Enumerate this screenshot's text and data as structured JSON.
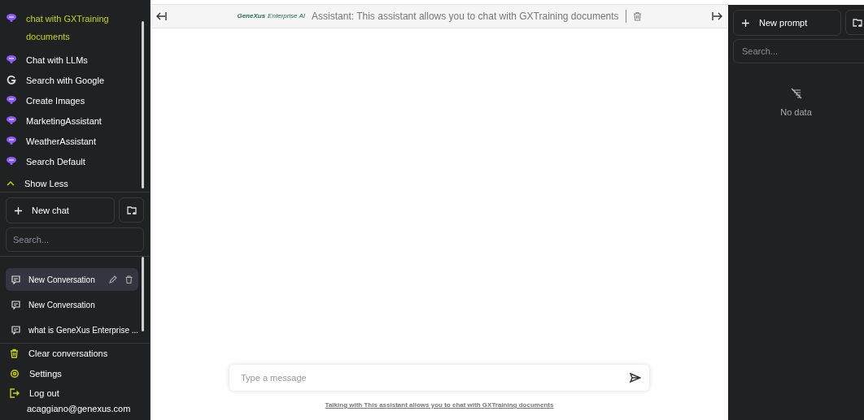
{
  "assistants": [
    {
      "label": "chat with GXTraining documents",
      "kind": "assistant",
      "selected": true
    },
    {
      "label": "Chat with LLMs",
      "kind": "assistant",
      "selected": false
    },
    {
      "label": "Search with Google",
      "kind": "google",
      "selected": false
    },
    {
      "label": "Create Images",
      "kind": "assistant",
      "selected": false
    },
    {
      "label": "MarketingAssistant",
      "kind": "assistant",
      "selected": false
    },
    {
      "label": "WeatherAssistant",
      "kind": "assistant",
      "selected": false
    },
    {
      "label": "Search Default",
      "kind": "assistant",
      "selected": false
    }
  ],
  "show_less": "Show Less",
  "new_chat": "New chat",
  "chat_search": {
    "placeholder": "Search..."
  },
  "conversations": [
    {
      "title": "New Conversation",
      "selected": true
    },
    {
      "title": "New Conversation",
      "selected": false
    },
    {
      "title": "what is GeneXus Enterprise ...",
      "selected": false
    }
  ],
  "footer_items": [
    {
      "label": "Clear conversations",
      "kind": "clear"
    },
    {
      "label": "Settings",
      "kind": "settings"
    },
    {
      "label": "Log out",
      "kind": "logout"
    }
  ],
  "user_email": "acaggiano@genexus.com",
  "header": {
    "logo_brand": "GeneXus",
    "logo_product": "Enterprise AI",
    "assistant": "Assistant: This assistant allows you to chat with GXTraining documents"
  },
  "composer": {
    "placeholder": "Type a message"
  },
  "talking_with": "Talking with This assistant allows you to chat with GXTraining documents",
  "prompts": {
    "new_prompt": "New prompt",
    "search_placeholder": "Search...",
    "empty": "No data"
  }
}
